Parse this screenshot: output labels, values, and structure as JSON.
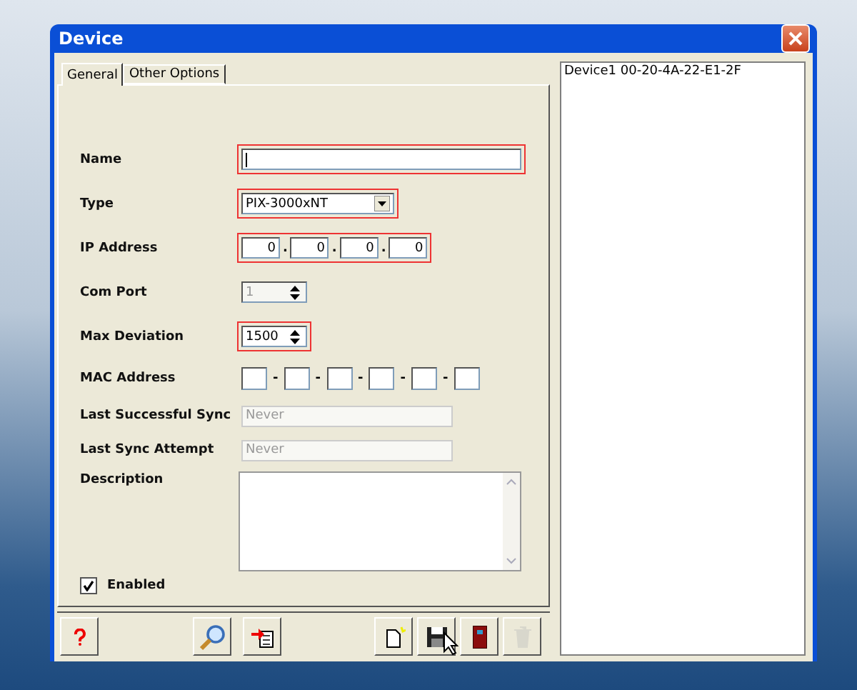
{
  "window": {
    "title": "Device"
  },
  "tabs": [
    {
      "label": "General",
      "selected": true
    },
    {
      "label": "Other Options",
      "selected": false
    }
  ],
  "fields": [
    {
      "kind": "text",
      "label": "Name",
      "required": true,
      "disabled": false
    },
    {
      "kind": "combo",
      "label": "Type",
      "value": "PIX-3000xNT",
      "required": true,
      "disabled": false
    },
    {
      "kind": "ip",
      "label": "IP Address",
      "octets": [
        "0",
        "0",
        "0",
        "0"
      ],
      "separator": ".",
      "required": true,
      "disabled": false
    },
    {
      "kind": "spin",
      "label": "Com Port",
      "value": "1",
      "required": false,
      "disabled": true
    },
    {
      "kind": "spin",
      "label": "Max Deviation",
      "value": "1500",
      "required": true,
      "disabled": false
    },
    {
      "kind": "mac",
      "label": "MAC Address",
      "separator": "-",
      "required": false,
      "disabled": false
    },
    {
      "kind": "readonly",
      "label": "Last Successful Sync",
      "value": "Never",
      "required": false,
      "disabled": true
    },
    {
      "kind": "readonly",
      "label": "Last Sync Attempt",
      "value": "Never",
      "required": false,
      "disabled": true
    },
    {
      "kind": "memo",
      "label": "Description",
      "required": false,
      "disabled": false
    }
  ],
  "enabled": {
    "label": "Enabled",
    "checked": true
  },
  "buttons": [
    {
      "kind": "help",
      "disabled": false
    },
    {
      "kind": "search",
      "disabled": false
    },
    {
      "kind": "import",
      "disabled": false
    },
    {
      "kind": "new",
      "disabled": false
    },
    {
      "kind": "save",
      "disabled": false
    },
    {
      "kind": "exit",
      "disabled": false
    },
    {
      "kind": "delete",
      "disabled": true
    }
  ],
  "devices": [
    {
      "label": "Device1 00-20-4A-22-E1-2F",
      "selected": false
    }
  ]
}
